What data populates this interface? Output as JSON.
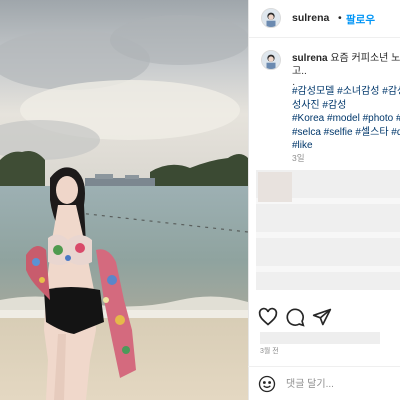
{
  "post": {
    "username": "sulrena",
    "follow_label": "팔로우",
    "separator": "•",
    "caption_text": "요즘 커피소년 노래",
    "caption_line2": "고..",
    "caption_line3": "·",
    "hashtags": [
      "#감성모델 #소녀감성 #감성",
      "성사진 #감성",
      "#Korea #model #photo #",
      "#selca #selfie #셀스타 #d",
      "#like"
    ],
    "time_ago": "3일",
    "date_label": "3월 전",
    "comment_placeholder": "댓글 달기..."
  },
  "icons": {
    "like": "heart-icon",
    "comment": "comment-icon",
    "share": "share-icon",
    "emoji": "emoji-icon"
  },
  "colors": {
    "link": "#0095f6",
    "hashtag": "#00376b",
    "text": "#262626",
    "muted": "#8e8e8e"
  }
}
